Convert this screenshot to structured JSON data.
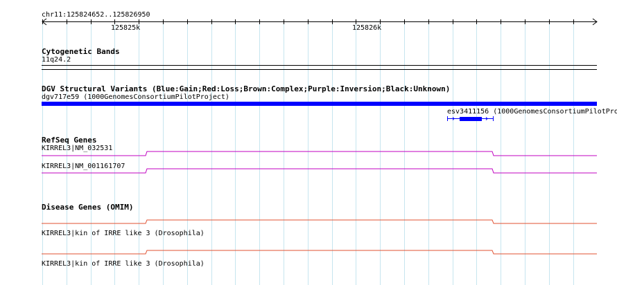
{
  "ruler": {
    "position": "chr11:125824652..125826950",
    "ticks": [
      "125825k",
      "125826k"
    ]
  },
  "tracks": {
    "cytogenetic": {
      "title": "Cytogenetic Bands",
      "band": "11q24.2"
    },
    "dgv": {
      "title": "DGV Structural Variants (Blue:Gain;Red:Loss;Brown:Complex;Purple:Inversion;Black:Unknown)",
      "variant1": "dgv717e59 (1000GenomesConsortiumPilotProject)",
      "variant2": "esv3411156 (1000GenomesConsortiumPilotPro"
    },
    "refseq": {
      "title": "RefSeq Genes",
      "genes": [
        "KIRREL3|NM_032531",
        "KIRREL3|NM_001161707"
      ]
    },
    "omim": {
      "title": "Disease Genes (OMIM)",
      "genes": [
        "KIRREL3|kin of IRRE like 3 (Drosophila)",
        "KIRREL3|kin of IRRE like 3 (Drosophila)"
      ]
    }
  },
  "colors": {
    "grid": "#c6e5ef",
    "dgv_gain": "#0000ff",
    "refseq": "#c000c0",
    "omim": "#e05030"
  }
}
